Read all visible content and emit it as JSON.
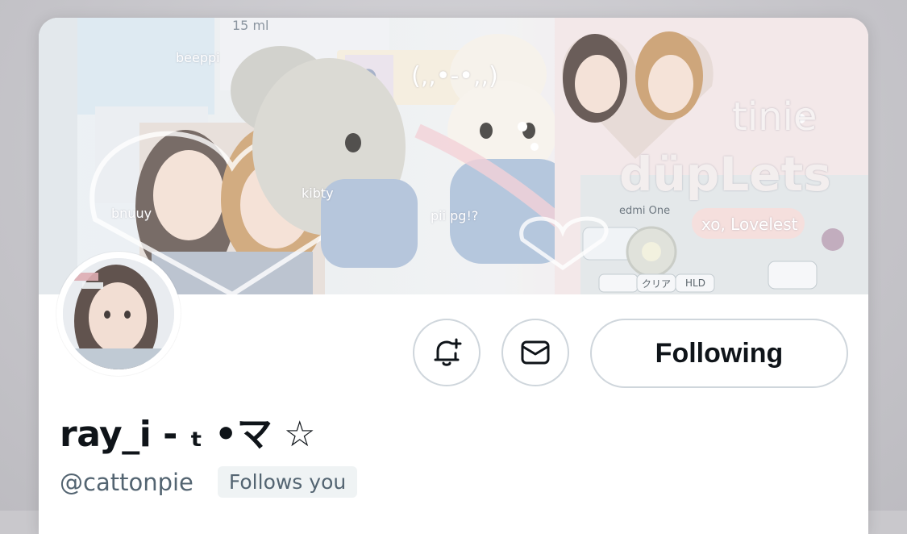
{
  "profile": {
    "display_name": "ray_i - ₜ •マ ☆",
    "handle": "@cattonpie",
    "follows_you_badge": "Follows you"
  },
  "actions": {
    "notify_icon": "bell-plus-icon",
    "message_icon": "envelope-icon",
    "follow_label": "Following"
  },
  "banner": {
    "texts": [
      "tinie",
      "düpLets",
      "xo, Lovelest",
      "(,,•-•,,)",
      "kibty",
      "pii pg!?",
      "bnuuy",
      "beeppi",
      "15 ml",
      "edmi One",
      "クリア",
      "HLD"
    ]
  },
  "colors": {
    "text_primary": "#0f1419",
    "text_secondary": "#536471",
    "button_border": "#cfd6dc",
    "badge_bg": "#eff3f4"
  }
}
